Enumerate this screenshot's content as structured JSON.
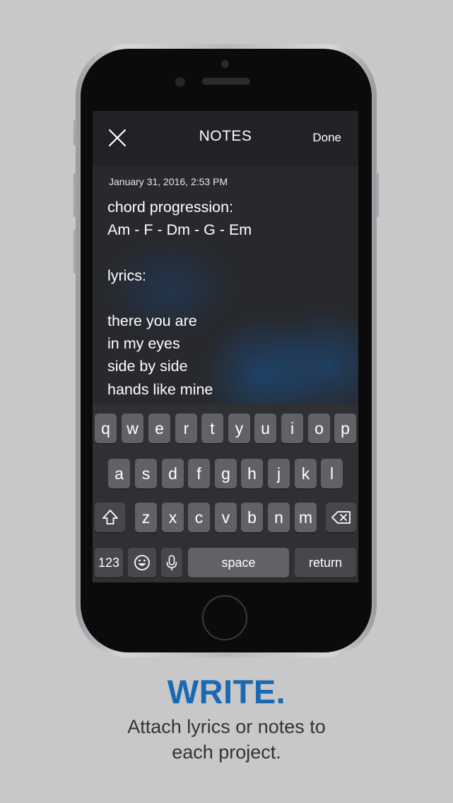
{
  "navbar": {
    "title": "NOTES",
    "done_label": "Done",
    "close_icon": "close-icon"
  },
  "note": {
    "date": "January 31, 2016, 2:53 PM",
    "lines": [
      "chord progression:",
      "Am - F - Dm - G - Em",
      "",
      "lyrics:",
      "",
      "there you are",
      "in my eyes",
      "side by side",
      "hands like mine"
    ]
  },
  "keyboard": {
    "row1": [
      "q",
      "w",
      "e",
      "r",
      "t",
      "y",
      "u",
      "i",
      "o",
      "p"
    ],
    "row2": [
      "a",
      "s",
      "d",
      "f",
      "g",
      "h",
      "j",
      "k",
      "l"
    ],
    "row3": [
      "z",
      "x",
      "c",
      "v",
      "b",
      "n",
      "m"
    ],
    "numbers_label": "123",
    "space_label": "space",
    "return_label": "return",
    "icons": [
      "shift-icon",
      "backspace-icon",
      "emoji-icon",
      "microphone-icon"
    ]
  },
  "caption": {
    "title": "WRITE.",
    "text_line1": "Attach lyrics or notes to",
    "text_line2": "each project."
  },
  "colors": {
    "background": "#c8c8c9",
    "accent": "#1a69b3",
    "screen": "#27292d",
    "key": "#606265",
    "function_key": "#46484b"
  }
}
